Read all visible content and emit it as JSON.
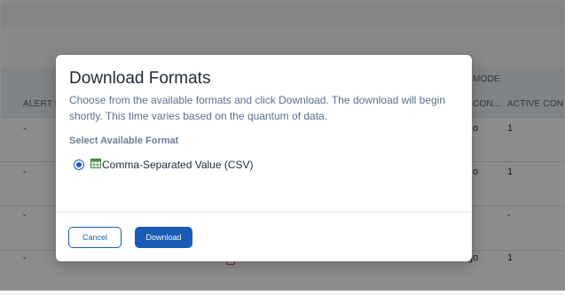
{
  "background": {
    "headers": {
      "alert_en": "ALERT EN",
      "mode": "MODE",
      "con": "CON...",
      "active_con": "ACTIVE CONN..."
    },
    "rows": [
      {
        "dash": "-",
        "con": "o",
        "active": "1"
      },
      {
        "dash": "-",
        "con": "o",
        "active": "1"
      },
      {
        "dash": "-",
        "con": "",
        "active": "-"
      },
      {
        "dash": "-",
        "con": "go",
        "active": "1"
      }
    ]
  },
  "modal": {
    "title": "Download Formats",
    "description": "Choose from the available formats and click Download. The download will begin shortly. This time varies based on the quantum of data.",
    "section_label": "Select Available Format",
    "formats": [
      {
        "label": "Comma-Separated Value (CSV)",
        "selected": true,
        "icon": "csv-file-icon"
      }
    ],
    "cancel_label": "Cancel",
    "download_label": "Download"
  },
  "colors": {
    "accent": "#1a5bb5",
    "overlay": "rgba(0,0,0,0.45)"
  }
}
